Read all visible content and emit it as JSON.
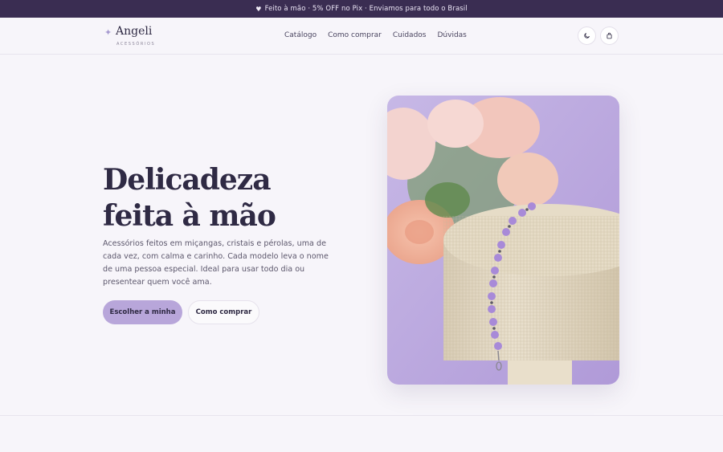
{
  "announcement": {
    "icon": "heart-icon",
    "text": "Feito à mão · 5% OFF no Pix · Enviamos para todo o Brasil"
  },
  "header": {
    "logo": {
      "icon": "sparkle-icon",
      "name": "Angeli",
      "tagline": "ACESSÓRIOS"
    },
    "nav": [
      {
        "label": "Catálogo"
      },
      {
        "label": "Como comprar"
      },
      {
        "label": "Cuidados"
      },
      {
        "label": "Dúvidas"
      }
    ],
    "actions": {
      "theme_icon": "moon-icon",
      "bag_icon": "shopping-bag-icon"
    }
  },
  "hero": {
    "title_line1": "Delicadeza",
    "title_line2": "feita à mão",
    "description": "Acessórios feitos em miçangas, cristais e pérolas, uma de cada vez, com calma e carinho. Cada modelo leva o nome de uma pessoa especial. Ideal para usar todo dia ou presentear quem você ama.",
    "primary_cta": "Escolher a minha",
    "secondary_cta": "Como comprar"
  },
  "colors": {
    "announcement_bg": "#3a2d52",
    "accent": "#b8a6da",
    "page_bg": "#f7f5fa",
    "text": "#2f2a44"
  }
}
